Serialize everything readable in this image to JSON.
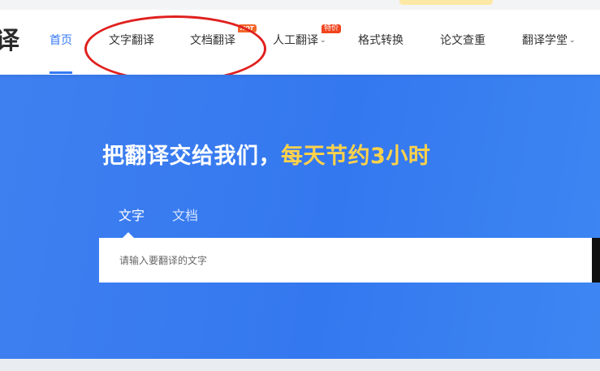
{
  "header": {
    "logo_partial": "译",
    "nav_items": [
      {
        "label": "首页",
        "active": true
      },
      {
        "label": "文字翻译"
      },
      {
        "label": "文档翻译",
        "badge": "HOT"
      },
      {
        "label": "人工翻译",
        "badge": "特价",
        "dropdown": true
      },
      {
        "label": "格式转换"
      },
      {
        "label": "论文查重"
      },
      {
        "label": "翻译学堂",
        "dropdown": true
      }
    ]
  },
  "hero": {
    "headline_main": "把翻译交给我们，",
    "headline_highlight": "每天节约3小时",
    "tabs": [
      {
        "label": "文字",
        "selected": true
      },
      {
        "label": "文档"
      }
    ],
    "input_placeholder": "请输入要翻译的文字",
    "input_value": ""
  },
  "icons": {
    "dropdown": "chevron-down-icon"
  },
  "colors": {
    "accent": "#3478f6",
    "hero_bg": "#3478ef",
    "highlight": "#ffd24a",
    "badge_hot": "#f2662a",
    "annotation": "#e0201e"
  }
}
